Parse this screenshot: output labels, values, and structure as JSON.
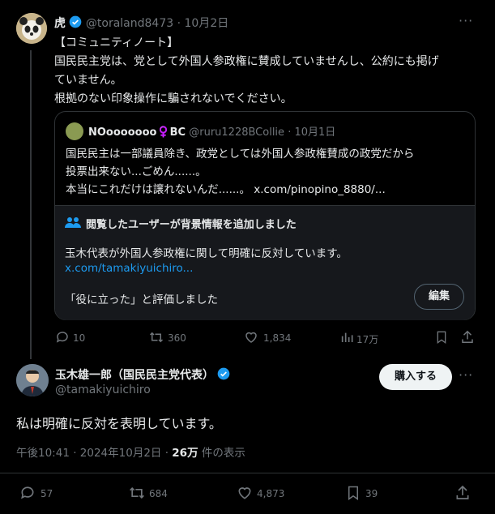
{
  "tweet1": {
    "name": "虎",
    "handle": "@toraland8473",
    "date": "10月2日",
    "lines": [
      "【コミュニティノート】",
      "国民民主党は、党として外国人参政権に賛成していませんし、公約にも掲げ",
      "ていません。",
      "根拠のない印象操作に騙されないでください。"
    ],
    "actions": {
      "replies": "10",
      "retweets": "360",
      "likes": "1,834",
      "views": "17万"
    }
  },
  "quote": {
    "name": "NOooooooo♀️BC",
    "handle": "@ruru1228BCollie",
    "date": "10月1日",
    "lines": [
      "国民民主は一部議員除き、政党としては外国人参政権賛成の政党だから",
      "投票出来ない...ごめん......。",
      "本当にこれだけは譲れないんだ......。 x.com/pinopino_8880/..."
    ]
  },
  "note": {
    "header": "閲覧したユーザーが背景情報を追加しました",
    "text": "玉木代表が外国人参政権に関して明確に反対しています。",
    "link": "x.com/tamakiyuichiro...",
    "rated": "「役に立った」と評価しました",
    "edit": "編集"
  },
  "tweet2": {
    "name": "玉木雄一郎（国民民主党代表）",
    "handle": "@tamakiyuichiro",
    "follow": "購入する",
    "text": "私は明確に反対を表明しています。",
    "meta_time": "午後10:41 · 2024年10月2日 · ",
    "meta_views": "26万",
    "meta_suffix": " 件の表示",
    "actions": {
      "replies": "57",
      "retweets": "684",
      "likes": "4,873",
      "bookmarks": "39"
    }
  },
  "colors": {
    "accent": "#1d9bf0",
    "background": "#000000",
    "muted": "#71767b"
  }
}
